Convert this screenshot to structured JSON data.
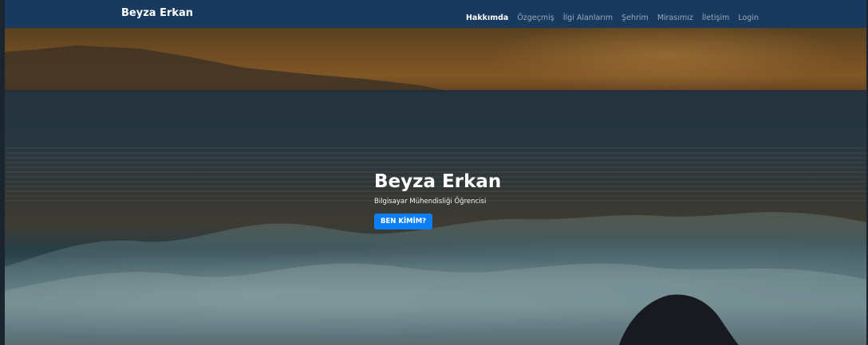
{
  "navbar": {
    "brand": "Beyza Erkan",
    "links": [
      {
        "label": "Hakkımda",
        "active": true
      },
      {
        "label": "Özgeçmiş",
        "active": false
      },
      {
        "label": "İlgi Alanlarım",
        "active": false
      },
      {
        "label": "Şehrim",
        "active": false
      },
      {
        "label": "Mirasımız",
        "active": false
      },
      {
        "label": "İletişim",
        "active": false
      },
      {
        "label": "Login",
        "active": false
      }
    ]
  },
  "hero": {
    "title": "Beyza Erkan",
    "subtitle": "Bilgisayar Mühendisliği Öğrencisi",
    "button_label": "BEN KİMİM?",
    "background_image": "sunset-sea-waves-photo"
  },
  "colors": {
    "navbar_bg": "#173a5e",
    "button_bg": "#0d7ff5",
    "text_white": "#ffffff"
  }
}
